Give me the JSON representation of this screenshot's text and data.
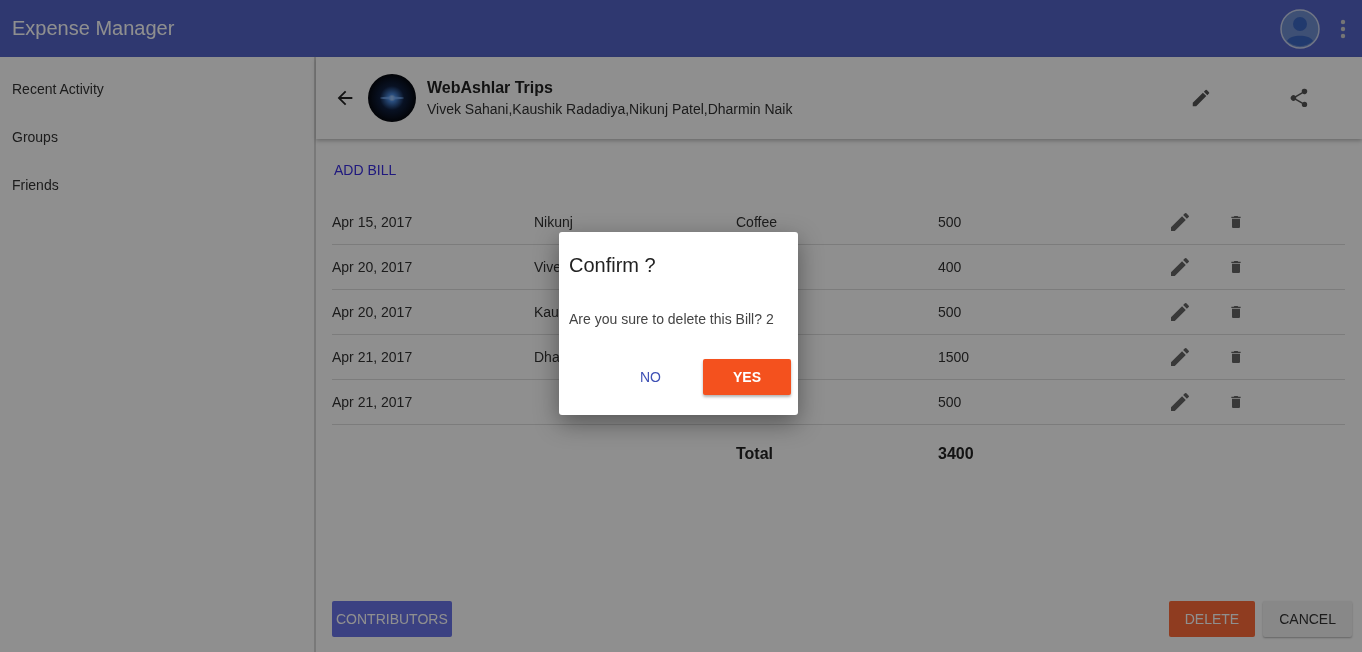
{
  "app_bar": {
    "title": "Expense Manager"
  },
  "sidebar": {
    "items": [
      {
        "label": "Recent Activity",
        "selected": false
      },
      {
        "label": "Groups",
        "selected": false
      },
      {
        "label": "Friends",
        "selected": false
      }
    ]
  },
  "group": {
    "name": "WebAshlar Trips",
    "members": "Vivek Sahani,Kaushik Radadiya,Nikunj Patel,Dharmin Naik"
  },
  "add_bill": "ADD BILL",
  "bills": [
    {
      "date": "Apr 15, 2017",
      "paid_by": "Nikunj",
      "description": "Coffee",
      "amount": "500"
    },
    {
      "date": "Apr 20, 2017",
      "paid_by": "Vive",
      "amount": "400"
    },
    {
      "date": "Apr 20, 2017",
      "paid_by": "Kau",
      "amount": "500"
    },
    {
      "date": "Apr 21, 2017",
      "paid_by": "Dha",
      "amount": "1500"
    },
    {
      "date": "Apr 21, 2017",
      "amount": "500"
    }
  ],
  "total": {
    "label": "Total",
    "amount": "3400"
  },
  "footer": {
    "contributors": "CONTRIBUTORS",
    "delete": "DELETE",
    "cancel": "CANCEL"
  },
  "dialog": {
    "title": "Confirm ?",
    "message": "Are you sure to delete this Bill? 2",
    "no": "NO",
    "yes": "YES"
  }
}
